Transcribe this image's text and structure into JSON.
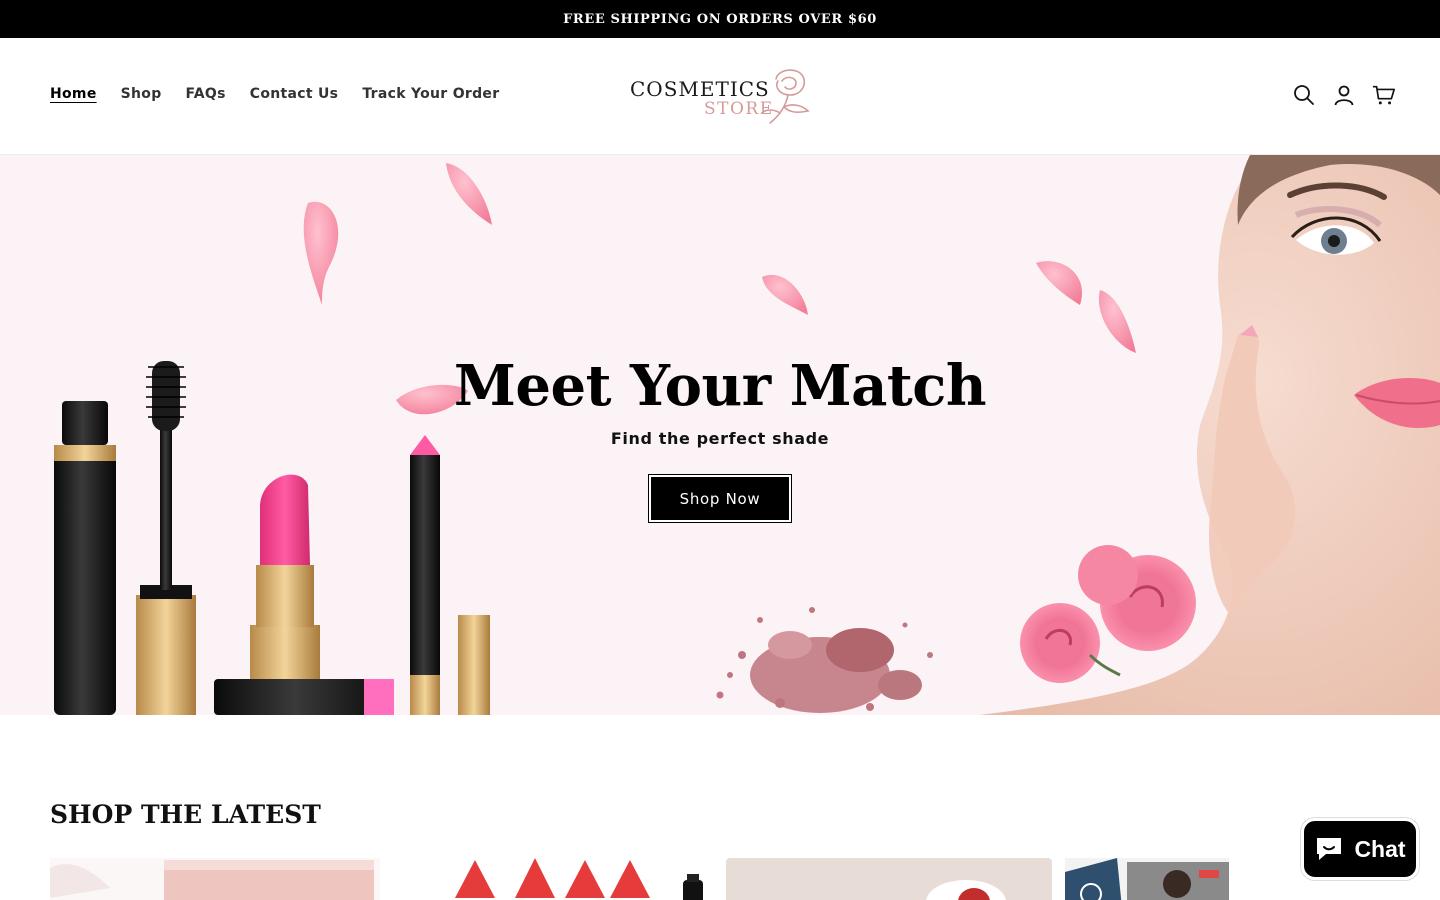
{
  "announcement": "FREE SHIPPING ON ORDERS OVER $60",
  "nav": {
    "items": [
      "Home",
      "Shop",
      "FAQs",
      "Contact Us",
      "Track Your Order"
    ],
    "active": "Home"
  },
  "logo": {
    "line1": "COSMETICS",
    "line2": "STORE",
    "icon": "rose-icon"
  },
  "header_icons": [
    "search-icon",
    "account-icon",
    "cart-icon"
  ],
  "hero": {
    "title": "Meet Your Match",
    "subtitle": "Find the perfect shade",
    "cta_label": "Shop Now"
  },
  "section": {
    "title": "SHOP THE LATEST"
  },
  "chat": {
    "label": "Chat",
    "icon": "chat-bubble-icon"
  },
  "colors": {
    "announcement_bg": "#000000",
    "hero_bg": "#fcf3f7",
    "brand_pink": "#d59a9a",
    "cta_bg": "#000000"
  }
}
